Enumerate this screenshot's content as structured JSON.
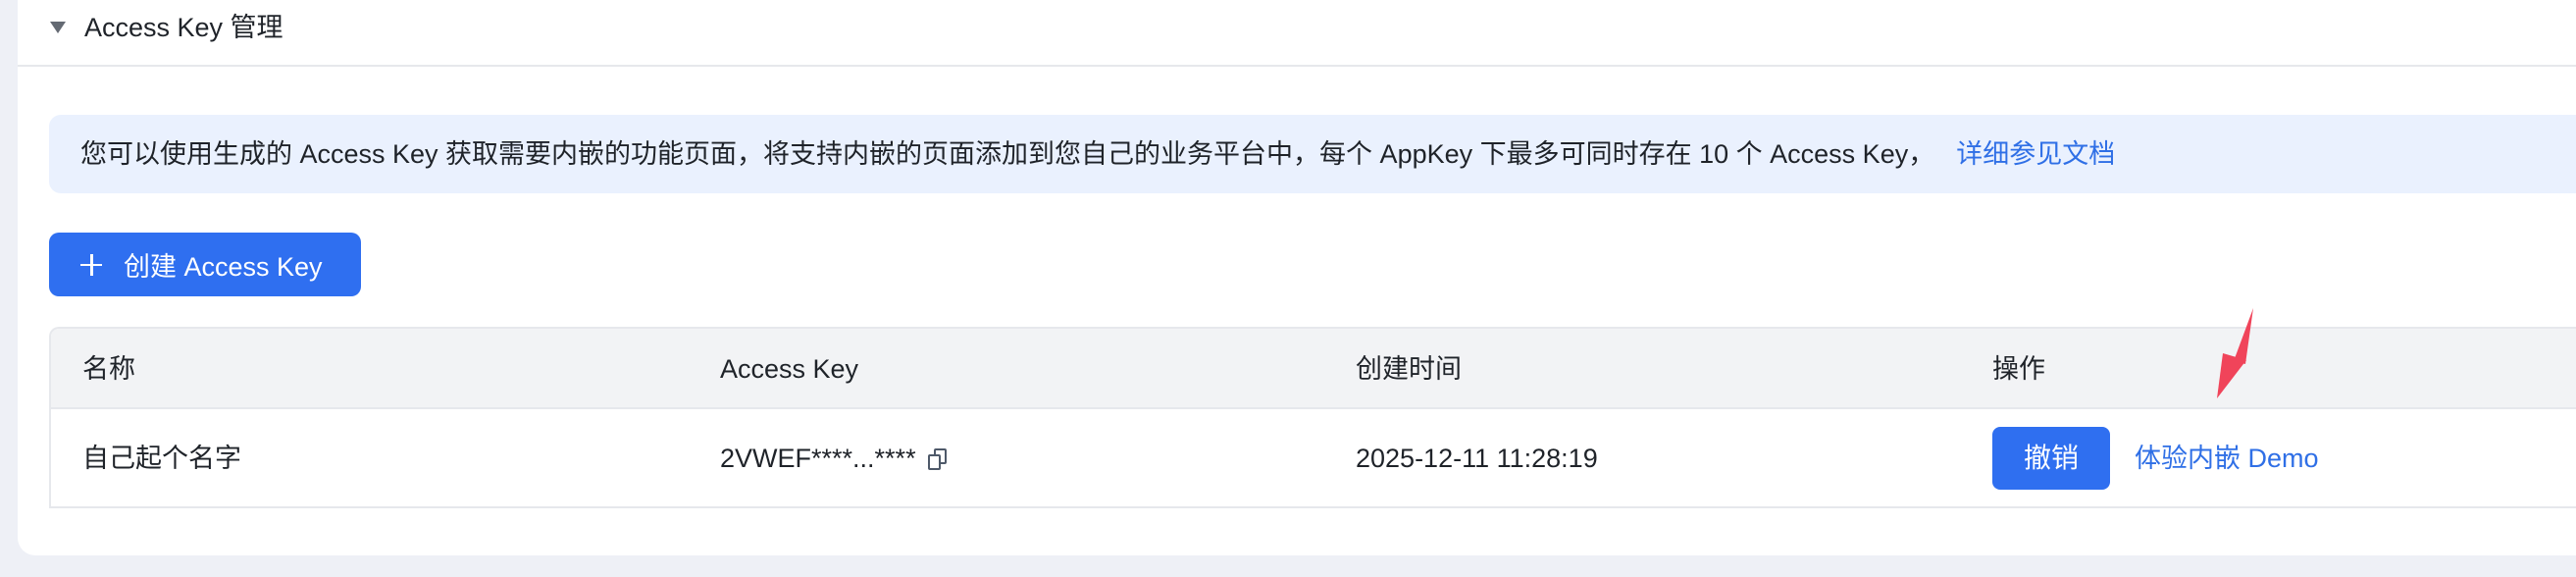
{
  "section": {
    "title": "Access Key 管理"
  },
  "notice": {
    "text": "您可以使用生成的 Access Key 获取需要内嵌的功能页面，将支持内嵌的页面添加到您自己的业务平台中，每个 AppKey 下最多可同时存在 10 个 Access Key，",
    "link": "详细参见文档"
  },
  "toolbar": {
    "create_label": "创建 Access Key"
  },
  "table": {
    "columns": [
      "名称",
      "Access Key",
      "创建时间",
      "操作"
    ],
    "rows": [
      {
        "name": "自己起个名字",
        "access_key": "2VWEF****...****",
        "created_at": "2025-12-11 11:28:19",
        "revoke_label": "撤销",
        "demo_label": "体验内嵌 Demo"
      }
    ]
  },
  "colors": {
    "primary": "#2f6ff0",
    "link": "#2f6fe6",
    "notice_bg": "#eaf1fe",
    "annotation_arrow": "#f0445a"
  }
}
